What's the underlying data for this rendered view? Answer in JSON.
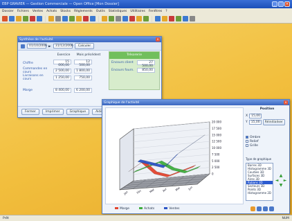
{
  "app": {
    "title": "EBP GRAVIER — Gestion Commerciale — Open Office [Mon Dossier]",
    "menu": [
      "Dossier",
      "Fichiers",
      "Ventes",
      "Achats",
      "Stocks",
      "Règlements",
      "Outils",
      "Statistiques",
      "Utilitaires",
      "Fenêtres",
      "?"
    ],
    "toolbar_colors": [
      "#d9552b",
      "#3c7ad1",
      "#e4a72a",
      "#6c9d3a",
      "#c83a3a",
      "#3c7ad1",
      "#e4a72a",
      "#888",
      "#3c7ad1",
      "#6c9d3a",
      "#e4a72a",
      "#c83a3a",
      "#3c7ad1",
      "#e4a72a",
      "#6c9d3a",
      "#888",
      "#3c7ad1",
      "#c83a3a",
      "#e4a72a",
      "#6c9d3a",
      "#3c7ad1",
      "#e4a72a",
      "#c83a3a",
      "#6c9d3a",
      "#3c7ad1",
      "#888"
    ],
    "status_left": "Prêt",
    "status_right": "NUM"
  },
  "window1": {
    "title": "Synthèse de l'activité",
    "date_from": "01/10/2006",
    "date_to": "31/12/2006",
    "period_button": "Calculer",
    "col_headers": [
      "Exercice",
      "Mois précédent"
    ],
    "rows": [
      {
        "label": "Chiffre",
        "v1": "15 000,00",
        "v2": "12 500,00"
      },
      {
        "label": "Commandes en cours",
        "v1": "2 500,00",
        "v2": "1 800,00"
      },
      {
        "label": "Livraisons en cours",
        "v1": "1 250,00",
        "v2": "750,00"
      },
      {
        "label": "Marge",
        "v1": "8 400,00",
        "v2": "6 200,00"
      }
    ],
    "green_header": "Trésorerie",
    "green_rows": [
      {
        "label": "Encours client",
        "value": "27 500,00"
      },
      {
        "label": "Encours fourn.",
        "value": "850,00"
      }
    ],
    "buttons": [
      "Fermer",
      "Imprimer",
      "Graphique",
      "Aide"
    ]
  },
  "window2": {
    "title": "Graphique de l'activité",
    "panel_title": "Position",
    "x_label": "X",
    "y_label": "Y",
    "x_value": "15,00",
    "y_value": "15,00",
    "reset_button": "Réinitialiser",
    "checks": [
      {
        "label": "Ombre",
        "on": true
      },
      {
        "label": "Relief",
        "on": false
      },
      {
        "label": "Grille",
        "on": false
      }
    ],
    "list_title": "Type de graphique",
    "list_items": [
      "Barres 3D",
      "Histogramme 3D",
      "Courbes 3D",
      "Surfaces 3D",
      "Aires 3D",
      "Rubans 3D",
      "Secteurs 3D",
      "Points 3D",
      "Histogramme 2D"
    ],
    "selected_index": 5,
    "legend": [
      "Marge",
      "Achats",
      "Ventes"
    ],
    "legend_colors": [
      "#e2452f",
      "#3fae3f",
      "#2b55c6"
    ]
  },
  "chart_data": {
    "type": "line",
    "categories": [
      "Jan",
      "Fév",
      "Mar",
      "Avr",
      "Mai",
      "Jun"
    ],
    "series": [
      {
        "name": "Marge",
        "values": [
          4,
          6,
          3,
          2,
          3,
          4
        ]
      },
      {
        "name": "Achats",
        "values": [
          3,
          4,
          5,
          3,
          2,
          3
        ]
      },
      {
        "name": "Ventes",
        "values": [
          5,
          4,
          3,
          6,
          8,
          10
        ]
      }
    ],
    "y_ticks": [
      "20 000",
      "17 500",
      "15 000",
      "12 500",
      "10 000",
      "7 500",
      "5 000",
      "2 500",
      "0"
    ],
    "title": "",
    "xlabel": "",
    "ylabel": ""
  }
}
